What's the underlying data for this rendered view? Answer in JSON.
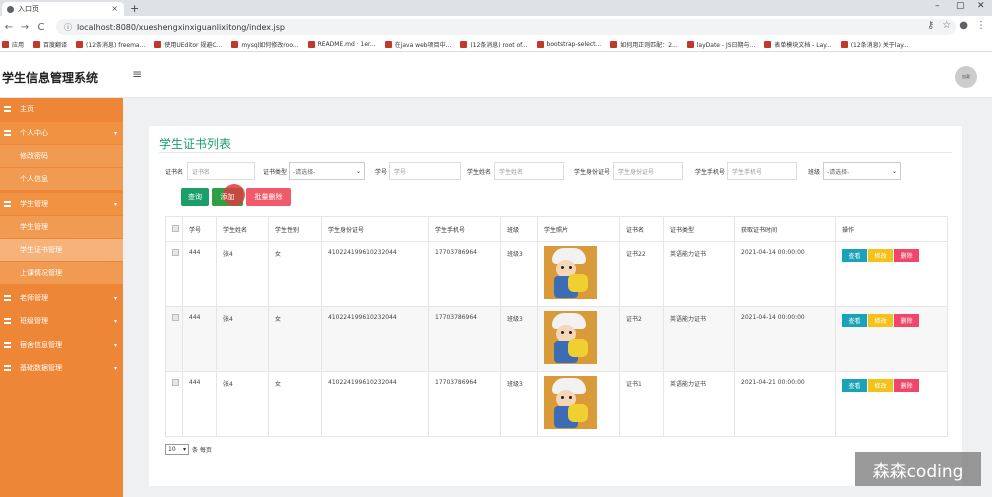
{
  "browser": {
    "tab_title": "入口页",
    "tab_close": "×",
    "new_tab": "+",
    "win_min": "–",
    "win_max": "▢",
    "win_close": "✕",
    "back": "←",
    "forward": "→",
    "reload": "C",
    "url": "localhost:8080/xueshengxinxiguanlixitong/index.jsp",
    "bookmarks": [
      "应用",
      "百度翻译",
      "(12条消息) freema...",
      "使用UEditor 规避C...",
      "mysql如何修改roo...",
      "README.md · 1er...",
      "在java web项目中...",
      "(12条消息) root of...",
      "bootstrap-select...",
      "如何用正则匹配：2...",
      "layDate - JS日期与...",
      "表单模块文档 - Lay...",
      "(12条消息) 关于lay..."
    ]
  },
  "header": {
    "title": "学生信息管理系统",
    "menu_icon": "≡",
    "avatar_text": "加载"
  },
  "sidebar": {
    "items": [
      {
        "label": "主页"
      },
      {
        "label": "个人中心"
      },
      {
        "label": "修改密码"
      },
      {
        "label": "个人信息"
      },
      {
        "label": "学生管理"
      },
      {
        "label": "学生管理"
      },
      {
        "label": "学生证书管理"
      },
      {
        "label": "上课情况管理"
      },
      {
        "label": "老师管理"
      },
      {
        "label": "班级管理"
      },
      {
        "label": "宿舍信息管理"
      },
      {
        "label": "基础数据管理"
      }
    ],
    "caret": "▾"
  },
  "panel": {
    "title": "学生证书列表",
    "filters": {
      "cert_name_label": "证书名",
      "cert_name_placeholder": "证书名",
      "cert_type_label": "证书类型",
      "cert_type_value": "-请选择-",
      "student_no_label": "学号",
      "student_no_placeholder": "学号",
      "student_name_label": "学生姓名",
      "student_name_placeholder": "学生姓名",
      "id_card_label": "学生身份证号",
      "id_card_placeholder": "学生身份证号",
      "phone_label": "学生手机号",
      "phone_placeholder": "学生手机号",
      "class_label": "班级",
      "class_value": "-请选择-"
    },
    "buttons": {
      "query": "查询",
      "add": "添加",
      "batch_delete": "批量删除"
    },
    "table": {
      "headers": [
        "学号",
        "学生姓名",
        "学生性别",
        "学生身份证号",
        "学生手机号",
        "班级",
        "学生照片",
        "证书名",
        "证书类型",
        "获取证书时间",
        "操作"
      ],
      "rows": [
        {
          "no": "444",
          "name": "张4",
          "gender": "女",
          "id_card": "410224199610232044",
          "phone": "17703786964",
          "class": "班级3",
          "cert": "证书22",
          "type": "英语能力证书",
          "time": "2021-04-14 00:00:00"
        },
        {
          "no": "444",
          "name": "张4",
          "gender": "女",
          "id_card": "410224199610232044",
          "phone": "17703786964",
          "class": "班级3",
          "cert": "证书2",
          "type": "英语能力证书",
          "time": "2021-04-14 00:00:00"
        },
        {
          "no": "444",
          "name": "张4",
          "gender": "女",
          "id_card": "410224199610232044",
          "phone": "17703786964",
          "class": "班级3",
          "cert": "证书1",
          "type": "英语能力证书",
          "time": "2021-04-21 00:00:00"
        }
      ],
      "actions": {
        "view": "查看",
        "edit": "修改",
        "delete": "删除"
      }
    },
    "pager": {
      "size": "10",
      "suffix": "条 每页"
    }
  },
  "watermark": "森森coding",
  "colors": {
    "sidebar": "#ee8637",
    "title_green": "#1a9e6a",
    "view": "#1aa2b8",
    "edit": "#f5c219",
    "delete": "#f0466a"
  }
}
